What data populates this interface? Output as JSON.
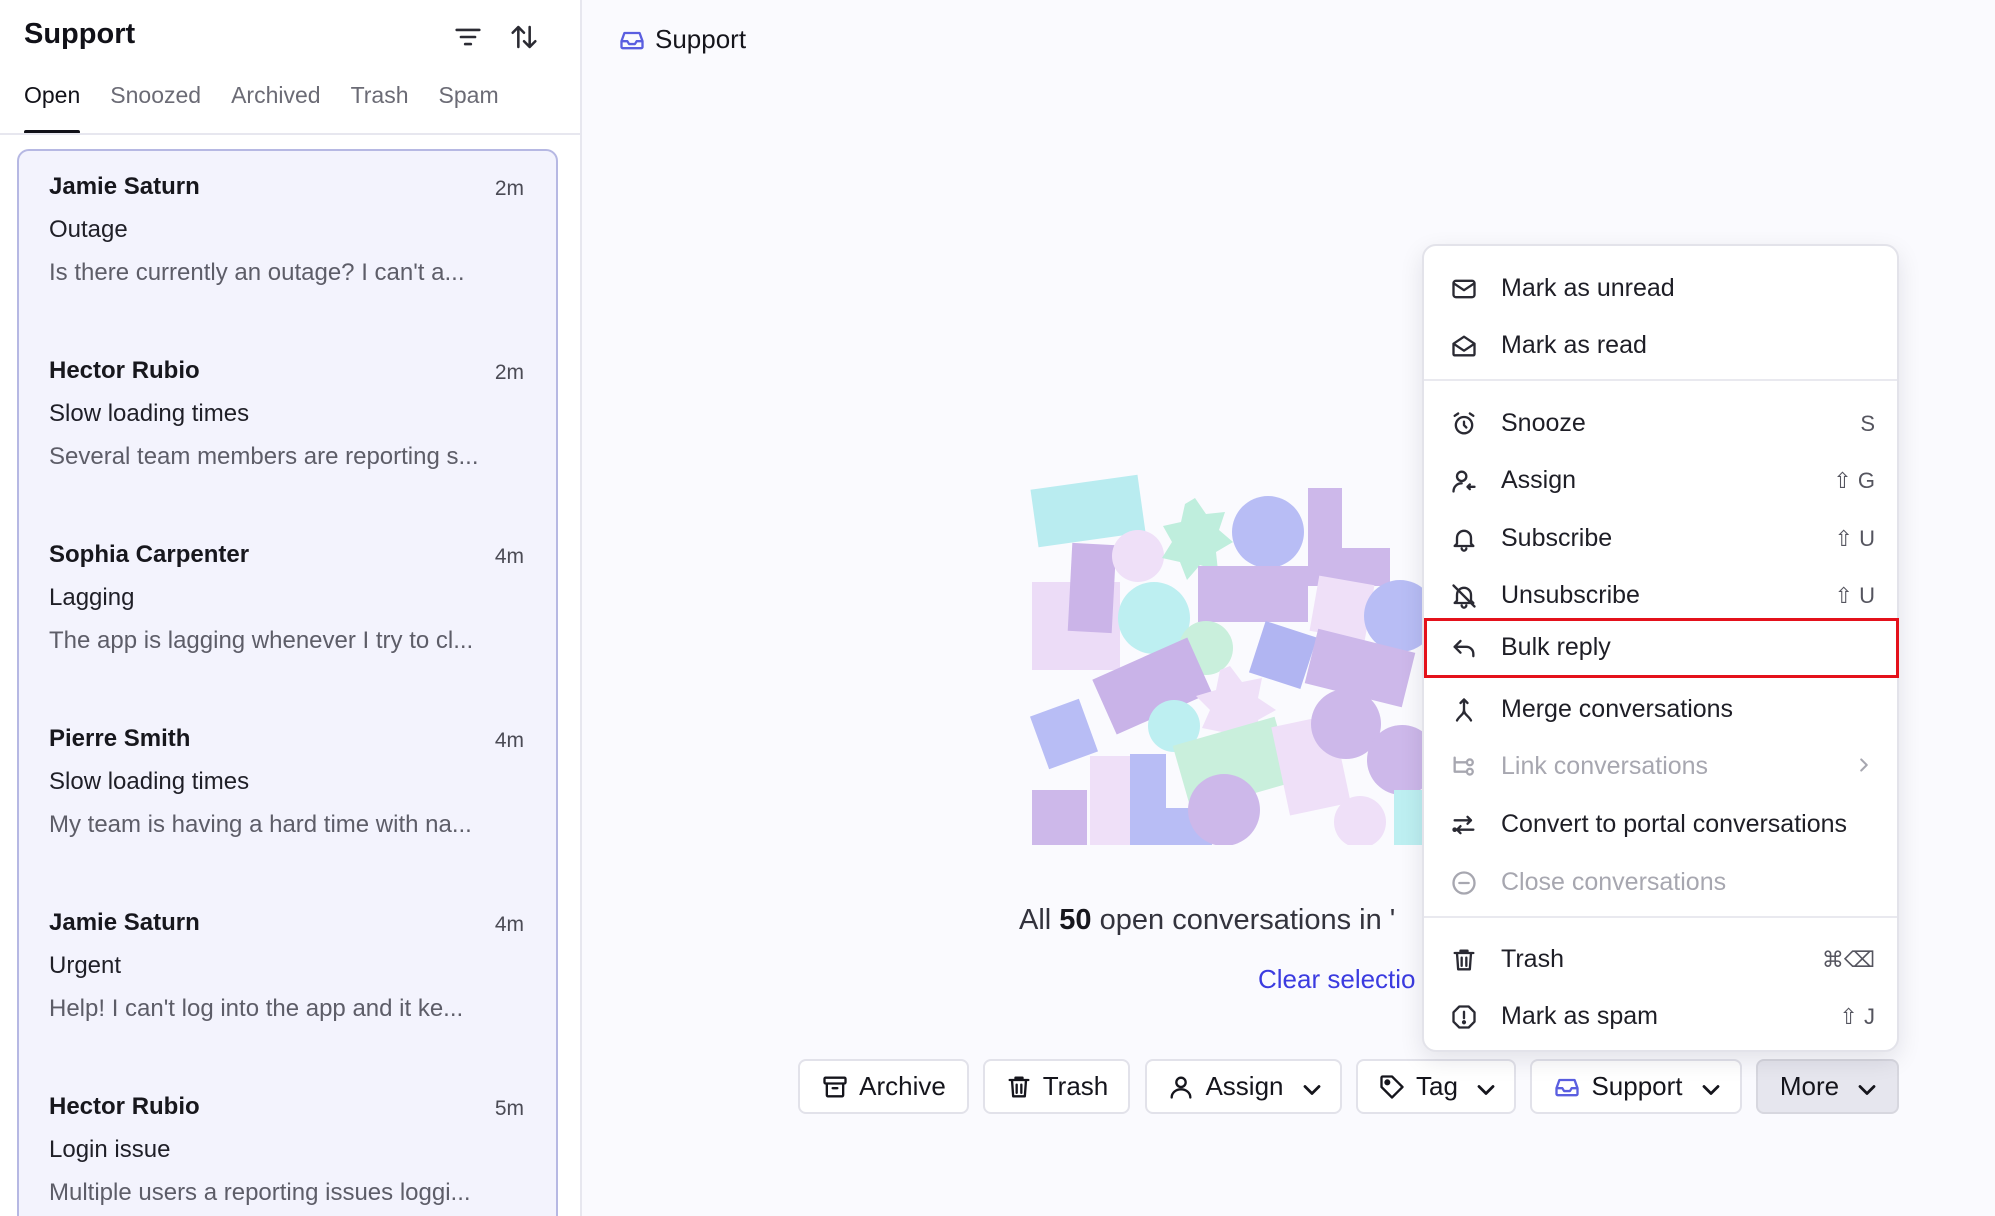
{
  "sidebar": {
    "title": "Support",
    "tabs": [
      {
        "label": "Open",
        "active": true
      },
      {
        "label": "Snoozed",
        "active": false
      },
      {
        "label": "Archived",
        "active": false
      },
      {
        "label": "Trash",
        "active": false
      },
      {
        "label": "Spam",
        "active": false
      }
    ],
    "conversations": [
      {
        "name": "Jamie Saturn",
        "time": "2m",
        "subject": "Outage",
        "preview": "Is there currently an outage? I can't a..."
      },
      {
        "name": "Hector Rubio",
        "time": "2m",
        "subject": "Slow loading times",
        "preview": "Several team members are reporting s..."
      },
      {
        "name": "Sophia Carpenter",
        "time": "4m",
        "subject": "Lagging",
        "preview": "The app is lagging whenever I try to cl..."
      },
      {
        "name": "Pierre Smith",
        "time": "4m",
        "subject": "Slow loading times",
        "preview": "My team is having a hard time with na..."
      },
      {
        "name": "Jamie Saturn",
        "time": "4m",
        "subject": "Urgent",
        "preview": "Help! I can't log into the app and it ke..."
      },
      {
        "name": "Hector Rubio",
        "time": "5m",
        "subject": "Login issue",
        "preview": "Multiple users a reporting issues loggi..."
      }
    ]
  },
  "main": {
    "header_title": "Support",
    "summary": {
      "prefix": "All ",
      "count": "50",
      "suffix": " open conversations in '"
    },
    "clear_selection": "Clear selectio"
  },
  "actions": {
    "archive": "Archive",
    "trash": "Trash",
    "assign": "Assign",
    "tag": "Tag",
    "inbox": "Support",
    "more": "More"
  },
  "menu": {
    "items": [
      {
        "label": "Mark as unread",
        "icon": "mail-icon",
        "shortcut": "",
        "disabled": false
      },
      {
        "label": "Mark as read",
        "icon": "mail-open-icon",
        "shortcut": "",
        "disabled": false
      },
      {
        "label": "Snooze",
        "icon": "alarm-clock-icon",
        "shortcut": "S",
        "disabled": false
      },
      {
        "label": "Assign",
        "icon": "user-assign-icon",
        "shortcut": "⇧ G",
        "disabled": false
      },
      {
        "label": "Subscribe",
        "icon": "bell-icon",
        "shortcut": "⇧ U",
        "disabled": false
      },
      {
        "label": "Unsubscribe",
        "icon": "bell-off-icon",
        "shortcut": "⇧ U",
        "disabled": false
      },
      {
        "label": "Bulk reply",
        "icon": "reply-icon",
        "shortcut": "",
        "disabled": false
      },
      {
        "label": "Merge conversations",
        "icon": "merge-icon",
        "shortcut": "",
        "disabled": false
      },
      {
        "label": "Link conversations",
        "icon": "link-tree-icon",
        "shortcut": "",
        "disabled": true
      },
      {
        "label": "Convert to portal conversations",
        "icon": "convert-icon",
        "shortcut": "",
        "disabled": false
      },
      {
        "label": "Close conversations",
        "icon": "minus-circle-icon",
        "shortcut": "",
        "disabled": true
      },
      {
        "label": "Trash",
        "icon": "trash-icon",
        "shortcut": "⌘⌫",
        "disabled": false
      },
      {
        "label": "Mark as spam",
        "icon": "spam-icon",
        "shortcut": "⇧ J",
        "disabled": false
      }
    ]
  },
  "colors": {
    "accent": "#3b3be0",
    "selection_bg": "#f3f3fd",
    "selection_border": "#b6b8e3",
    "highlight_box": "#e4111b"
  }
}
